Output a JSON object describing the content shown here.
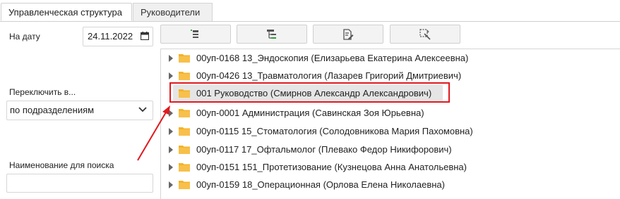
{
  "tabs": [
    {
      "label": "Управленческая структура",
      "active": true
    },
    {
      "label": "Руководители",
      "active": false
    }
  ],
  "filters": {
    "date_label": "На дату",
    "date_value": "24.11.2022",
    "switch_label": "Переключить в...",
    "switch_selected": "по подразделениям",
    "search_label": "Наименование для поиска",
    "search_value": ""
  },
  "toolbar": {
    "buttons": [
      {
        "icon": "add-child-icon"
      },
      {
        "icon": "hierarchy-icon"
      },
      {
        "icon": "edit-document-icon"
      },
      {
        "icon": "magic-select-icon"
      }
    ]
  },
  "tree": {
    "items": [
      {
        "label": "00уп-0168 13_Эндоскопия (Елизарьева Екатерина Алексеевна)",
        "expandable": true,
        "selected": false
      },
      {
        "label": "00уп-0426 13_Травматология (Лазарев Григорий Дмитриевич)",
        "expandable": true,
        "selected": false
      },
      {
        "label": "001 Руководство (Смирнов Александр Александрович)",
        "expandable": false,
        "selected": true
      },
      {
        "label": "00уп-0001 Администрация (Савинская Зоя Юрьевна)",
        "expandable": true,
        "selected": false
      },
      {
        "label": "00уп-0115 15_Стоматология (Солодовникова Мария Пахомовна)",
        "expandable": true,
        "selected": false
      },
      {
        "label": "00уп-0117 17_Офтальмолог (Плевако Федор Никифорович)",
        "expandable": true,
        "selected": false
      },
      {
        "label": "00уп-0151 151_Протетизование (Кузнецова Анна Анатольевна)",
        "expandable": true,
        "selected": false
      },
      {
        "label": "00уп-0159 18_Операционная (Орлова Елена Николаевна)",
        "expandable": true,
        "selected": false
      }
    ]
  },
  "colors": {
    "folder": "#f5b324",
    "annotation": "#e0191f",
    "selected_bg": "#e5e5e5"
  }
}
